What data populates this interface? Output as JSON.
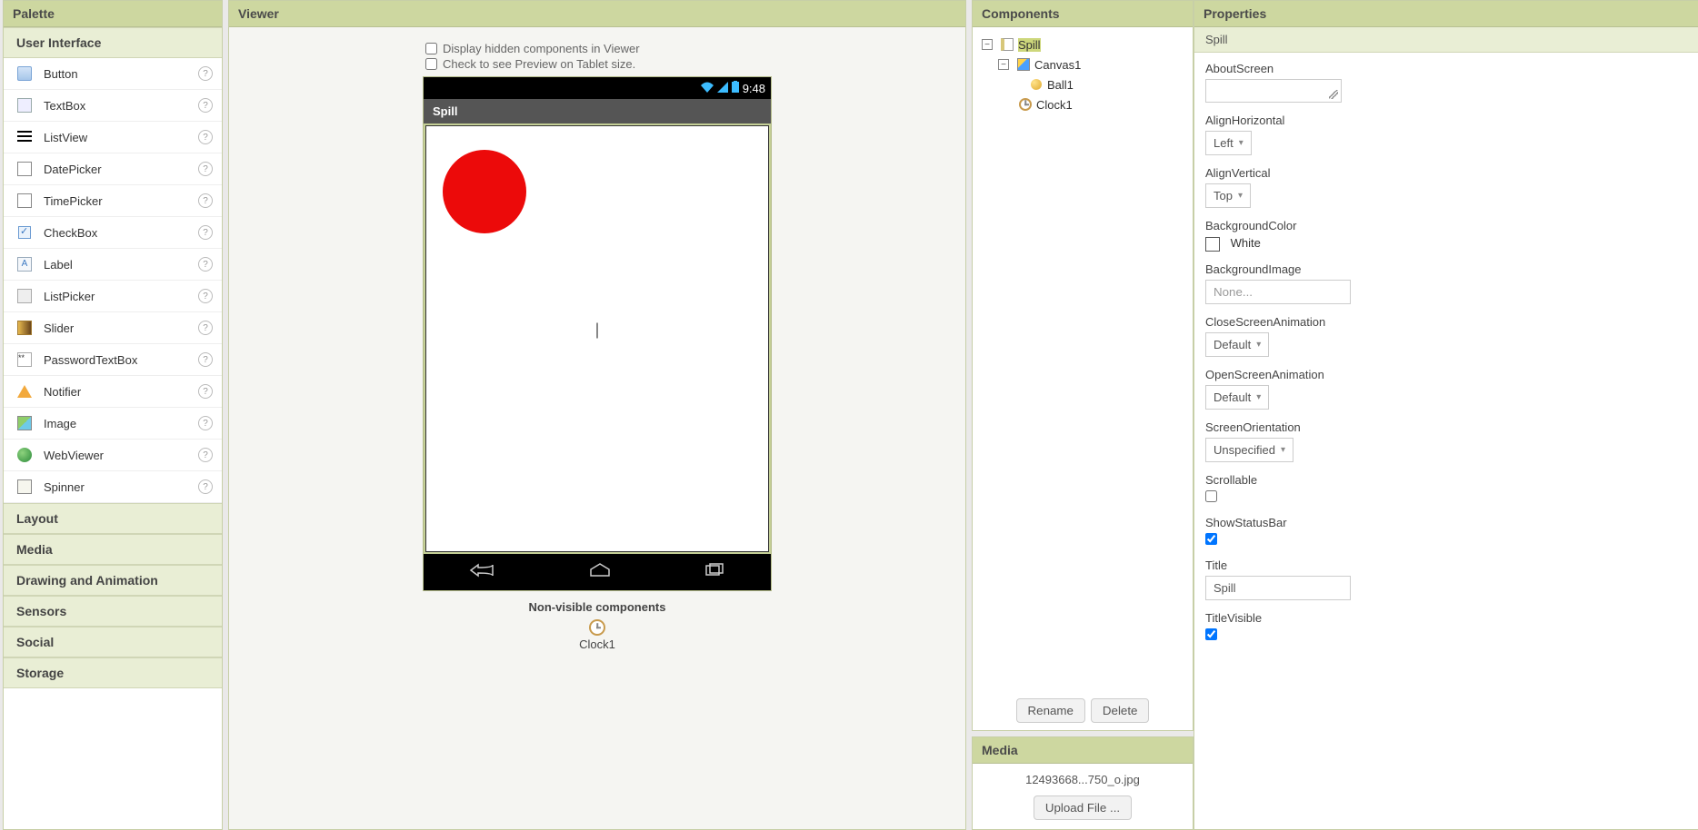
{
  "palette": {
    "title": "Palette",
    "sections": [
      "User Interface",
      "Layout",
      "Media",
      "Drawing and Animation",
      "Sensors",
      "Social",
      "Storage"
    ],
    "ui_items": [
      "Button",
      "TextBox",
      "ListView",
      "DatePicker",
      "TimePicker",
      "CheckBox",
      "Label",
      "ListPicker",
      "Slider",
      "PasswordTextBox",
      "Notifier",
      "Image",
      "WebViewer",
      "Spinner"
    ]
  },
  "viewer": {
    "title": "Viewer",
    "check1": "Display hidden components in Viewer",
    "check2": "Check to see Preview on Tablet size.",
    "status_time": "9:48",
    "app_title": "Spill",
    "nonvis_title": "Non-visible components",
    "nonvis_item": "Clock1"
  },
  "components": {
    "title": "Components",
    "tree": {
      "root": "Spill",
      "canvas": "Canvas1",
      "ball": "Ball1",
      "clock": "Clock1"
    },
    "rename": "Rename",
    "delete": "Delete"
  },
  "media": {
    "title": "Media",
    "file": "12493668...750_o.jpg",
    "upload": "Upload File ..."
  },
  "properties": {
    "title": "Properties",
    "subject": "Spill",
    "labels": {
      "about": "AboutScreen",
      "alignH": "AlignHorizontal",
      "alignV": "AlignVertical",
      "bgColor": "BackgroundColor",
      "bgColorVal": "White",
      "bgImg": "BackgroundImage",
      "bgImgVal": "None...",
      "closeAnim": "CloseScreenAnimation",
      "openAnim": "OpenScreenAnimation",
      "orient": "ScreenOrientation",
      "scroll": "Scrollable",
      "status": "ShowStatusBar",
      "titleLbl": "Title",
      "titleVal": "Spill",
      "titleVis": "TitleVisible"
    },
    "values": {
      "alignH": "Left",
      "alignV": "Top",
      "closeAnim": "Default",
      "openAnim": "Default",
      "orient": "Unspecified"
    }
  }
}
